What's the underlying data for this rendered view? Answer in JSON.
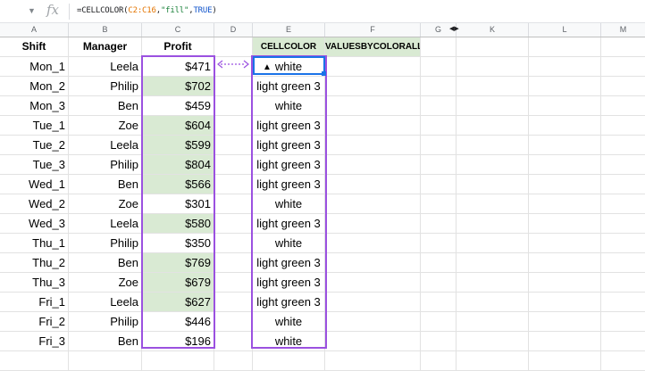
{
  "formula_bar": {
    "cell_ref": "",
    "fx_label": "fx",
    "formula_parts": [
      {
        "text": "=CELLCOLOR(",
        "cls": ""
      },
      {
        "text": "C2:C16",
        "cls": "t-orange"
      },
      {
        "text": ",",
        "cls": ""
      },
      {
        "text": "\"fill\"",
        "cls": "t-green"
      },
      {
        "text": ",",
        "cls": ""
      },
      {
        "text": "TRUE",
        "cls": "t-blue"
      },
      {
        "text": ")",
        "cls": ""
      }
    ]
  },
  "columns": [
    "A",
    "B",
    "C",
    "D",
    "E",
    "F",
    "G",
    "K",
    "L",
    "M"
  ],
  "header_row": {
    "a": "Shift",
    "b": "Manager",
    "c": "Profit",
    "d": "",
    "e": "CELLCOLOR",
    "f": "VALUESBYCOLORALL"
  },
  "rows": [
    {
      "shift": "Mon_1",
      "manager": "Leela",
      "profit": "$471",
      "color": "white",
      "green": false
    },
    {
      "shift": "Mon_2",
      "manager": "Philip",
      "profit": "$702",
      "color": "light green 3",
      "green": true
    },
    {
      "shift": "Mon_3",
      "manager": "Ben",
      "profit": "$459",
      "color": "white",
      "green": false
    },
    {
      "shift": "Tue_1",
      "manager": "Zoe",
      "profit": "$604",
      "color": "light green 3",
      "green": true
    },
    {
      "shift": "Tue_2",
      "manager": "Leela",
      "profit": "$599",
      "color": "light green 3",
      "green": true
    },
    {
      "shift": "Tue_3",
      "manager": "Philip",
      "profit": "$804",
      "color": "light green 3",
      "green": true
    },
    {
      "shift": "Wed_1",
      "manager": "Ben",
      "profit": "$566",
      "color": "light green 3",
      "green": true
    },
    {
      "shift": "Wed_2",
      "manager": "Zoe",
      "profit": "$301",
      "color": "white",
      "green": false
    },
    {
      "shift": "Wed_3",
      "manager": "Leela",
      "profit": "$580",
      "color": "light green 3",
      "green": true
    },
    {
      "shift": "Thu_1",
      "manager": "Philip",
      "profit": "$350",
      "color": "white",
      "green": false
    },
    {
      "shift": "Thu_2",
      "manager": "Ben",
      "profit": "$769",
      "color": "light green 3",
      "green": true
    },
    {
      "shift": "Thu_3",
      "manager": "Zoe",
      "profit": "$679",
      "color": "light green 3",
      "green": true
    },
    {
      "shift": "Fri_1",
      "manager": "Leela",
      "profit": "$627",
      "color": "light green 3",
      "green": true
    },
    {
      "shift": "Fri_2",
      "manager": "Philip",
      "profit": "$446",
      "color": "white",
      "green": false
    },
    {
      "shift": "Fri_3",
      "manager": "Ben",
      "profit": "$196",
      "color": "white",
      "green": false
    }
  ],
  "colors": {
    "fill_green": "#d9ead3",
    "selection_purple": "#9b51e0",
    "active_blue": "#1a73e8",
    "header_bg": "#f8f9fa"
  },
  "icons": {
    "namebox_dropdown": "chevron-down-icon",
    "hidden_columns": "hidden-columns-arrows-icon",
    "cursor": "mouse-pointer-icon",
    "link_arrow": "double-arrow-icon"
  }
}
